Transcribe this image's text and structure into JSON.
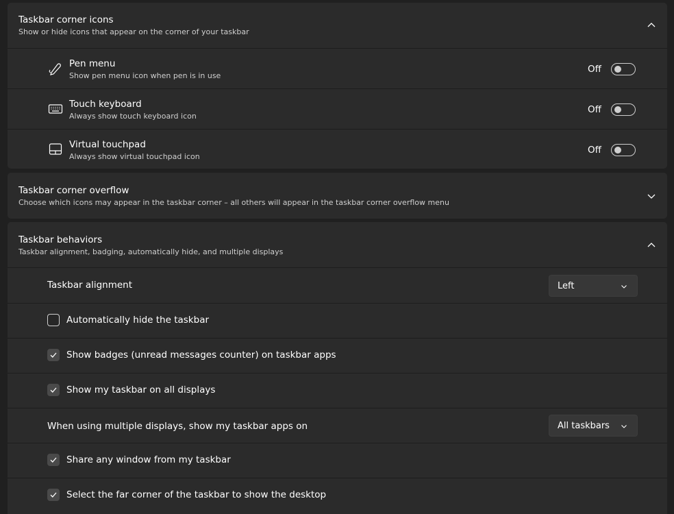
{
  "sections": {
    "corner_icons": {
      "title": "Taskbar corner icons",
      "description": "Show or hide icons that appear on the corner of your taskbar",
      "expanded": true,
      "items": [
        {
          "title": "Pen menu",
          "description": "Show pen menu icon when pen is in use",
          "icon": "pen-icon",
          "state_label": "Off",
          "on": false
        },
        {
          "title": "Touch keyboard",
          "description": "Always show touch keyboard icon",
          "icon": "keyboard-icon",
          "state_label": "Off",
          "on": false
        },
        {
          "title": "Virtual touchpad",
          "description": "Always show virtual touchpad icon",
          "icon": "touchpad-icon",
          "state_label": "Off",
          "on": false
        }
      ]
    },
    "corner_overflow": {
      "title": "Taskbar corner overflow",
      "description": "Choose which icons may appear in the taskbar corner – all others will appear in the taskbar corner overflow menu",
      "expanded": false
    },
    "behaviors": {
      "title": "Taskbar behaviors",
      "description": "Taskbar alignment, badging, automatically hide, and multiple displays",
      "expanded": true,
      "alignment": {
        "label": "Taskbar alignment",
        "value": "Left"
      },
      "auto_hide": {
        "label": "Automatically hide the taskbar",
        "checked": false
      },
      "badges": {
        "label": "Show badges (unread messages counter) on taskbar apps",
        "checked": true
      },
      "all_displays": {
        "label": "Show my taskbar on all displays",
        "checked": true
      },
      "multi_display": {
        "label": "When using multiple displays, show my taskbar apps on",
        "value": "All taskbars"
      },
      "share_window": {
        "label": "Share any window from my taskbar",
        "checked": true
      },
      "far_corner": {
        "label": "Select the far corner of the taskbar to show the desktop",
        "checked": true
      }
    }
  },
  "colors": {
    "background": "#202020",
    "card": "#2b2b2b",
    "text": "#ffffff",
    "secondary_text": "#cfcfcf",
    "checkbox_checked": "#4a4a4a"
  }
}
